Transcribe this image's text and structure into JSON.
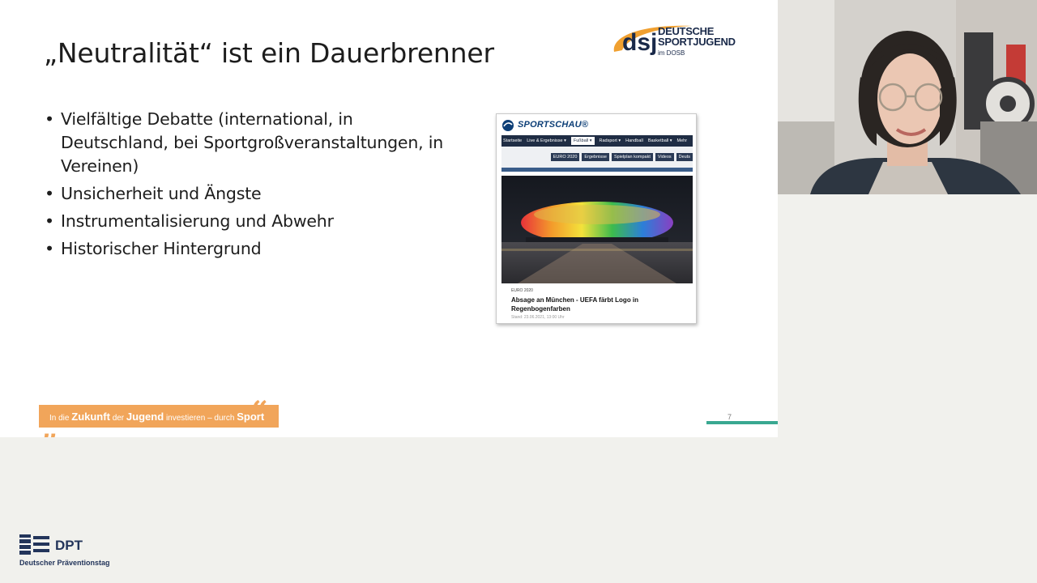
{
  "slide": {
    "title": "„Neutralität“ ist ein Dauerbrenner",
    "bullets": [
      "Vielfältige Debatte (international, in Deutschland, bei Sportgroßveranstaltungen, in Vereinen)",
      "Unsicherheit und Ängste",
      "Instrumentalisierung und Abwehr",
      "Historischer Hintergrund"
    ],
    "page_number": "7"
  },
  "dsj_logo": {
    "abbr": "dsj",
    "line1": "DEUTSCHE",
    "line2": "SPORTJUGEND",
    "line3": "im DOSB"
  },
  "inset": {
    "site_name": "SPORTSCHAU®",
    "nav_primary": [
      "Startseite",
      "Live & Ergebnisse ▾",
      "Fußball ▾",
      "Radsport ▾",
      "Handball",
      "Basketball ▾",
      "Mehr"
    ],
    "nav_active_index": 2,
    "nav_secondary": [
      "EURO 2020",
      "Ergebnisse",
      "Spielplan kompakt",
      "Videos",
      "Deuts"
    ],
    "kicker": "EURO 2020",
    "headline": "Absage an München - UEFA färbt Logo in Regenbogenfarben",
    "date": "Stand: 23.06.2021, 13:00 Uhr"
  },
  "banner": {
    "pre": "In die",
    "word1": "Zukunft",
    "mid": "der",
    "word2": "Jugend",
    "mid2": "investieren – durch",
    "word3": "Sport"
  },
  "dpt": {
    "abbr": "DPT",
    "name": "Deutscher Präventionstag"
  },
  "colors": {
    "banner_orange": "#f1a55a",
    "accent_green": "#3aa891",
    "dpt_blue": "#23355b",
    "dsj_orange": "#f0a030"
  }
}
